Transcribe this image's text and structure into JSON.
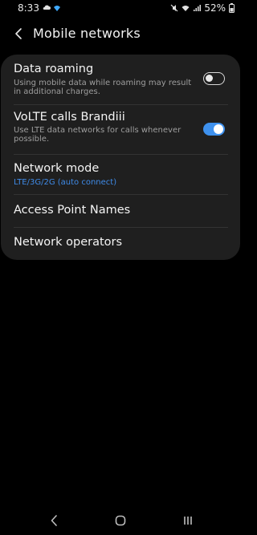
{
  "status_bar": {
    "time": "8:33",
    "battery_percent": "52%",
    "left_icons": [
      "cloud-icon",
      "wifi-calling-icon"
    ],
    "right_icons": [
      "mute-icon",
      "wifi-icon",
      "signal-icon",
      "battery-icon"
    ]
  },
  "header": {
    "title": "Mobile networks",
    "back_icon": "chevron-left-icon"
  },
  "settings": {
    "data_roaming": {
      "title": "Data roaming",
      "subtitle": "Using mobile data while roaming may result in additional charges.",
      "enabled": false
    },
    "volte": {
      "title": "VoLTE calls Brandiii",
      "subtitle": "Use LTE data networks for calls whenever possible.",
      "enabled": true
    },
    "network_mode": {
      "title": "Network mode",
      "value": "LTE/3G/2G (auto connect)"
    },
    "apn": {
      "title": "Access Point Names"
    },
    "operators": {
      "title": "Network operators"
    }
  },
  "colors": {
    "accent": "#3e91ee",
    "card_bg": "#1f1f1f",
    "value_blue": "#3f8be8"
  },
  "nav_bar": {
    "icons": [
      "back-icon",
      "home-icon",
      "recents-icon"
    ]
  }
}
